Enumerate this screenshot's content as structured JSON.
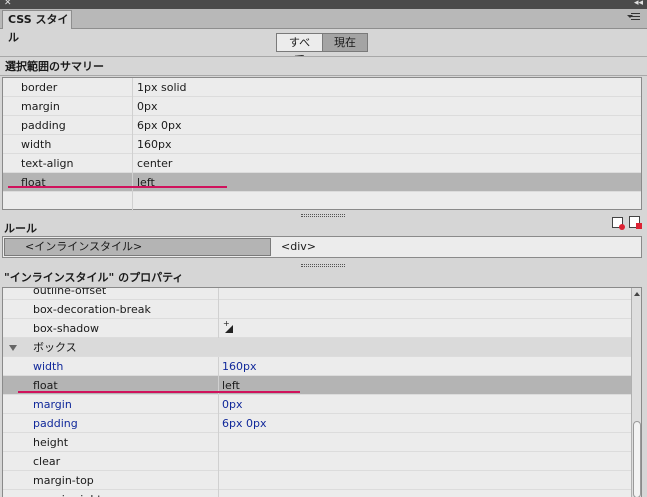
{
  "window": {
    "close_glyph": "✕",
    "collapse_glyph": "◂◂",
    "tab_label": "CSS スタイル"
  },
  "mode_toggle": {
    "all_label": "すべて",
    "current_label": "現在",
    "selected": "current"
  },
  "summary": {
    "title": "選択範囲のサマリー",
    "rows": [
      {
        "name": "border",
        "value": "1px solid"
      },
      {
        "name": "margin",
        "value": "0px"
      },
      {
        "name": "padding",
        "value": "6px 0px"
      },
      {
        "name": "width",
        "value": "160px"
      },
      {
        "name": "text-align",
        "value": "center"
      },
      {
        "name": "float",
        "value": "left",
        "selected": true
      }
    ]
  },
  "rules": {
    "title": "ルール",
    "selected_rule": "<インラインスタイル>",
    "element": "<div>"
  },
  "properties": {
    "title": "\"インラインスタイル\" のプロパティ",
    "rows": [
      {
        "name": "outline-offset",
        "value": ""
      },
      {
        "name": "box-decoration-break",
        "value": ""
      },
      {
        "name": "box-shadow",
        "value": ""
      },
      {
        "name": "ボックス",
        "value": "",
        "category": true
      },
      {
        "name": "width",
        "value": "160px",
        "set": true
      },
      {
        "name": "float",
        "value": "left",
        "set": true,
        "selected": true
      },
      {
        "name": "margin",
        "value": "0px",
        "set": true
      },
      {
        "name": "padding",
        "value": "6px 0px",
        "set": true
      },
      {
        "name": "height",
        "value": ""
      },
      {
        "name": "clear",
        "value": ""
      },
      {
        "name": "margin-top",
        "value": ""
      },
      {
        "name": "margin-right",
        "value": ""
      }
    ]
  },
  "colors": {
    "highlight_line": "#d0125c",
    "set_property_text": "#10289a",
    "selected_row": "#b4b4b4"
  },
  "icons": {
    "close": "close-icon",
    "collapse": "double-chevron-icon",
    "panel_menu": "panel-menu-icon",
    "attach_stylesheet": "attach-stylesheet-icon",
    "new_rule": "new-css-rule-icon",
    "box_shadow_add": "add-shadow-icon",
    "category_toggle": "disclosure-triangle-icon"
  }
}
